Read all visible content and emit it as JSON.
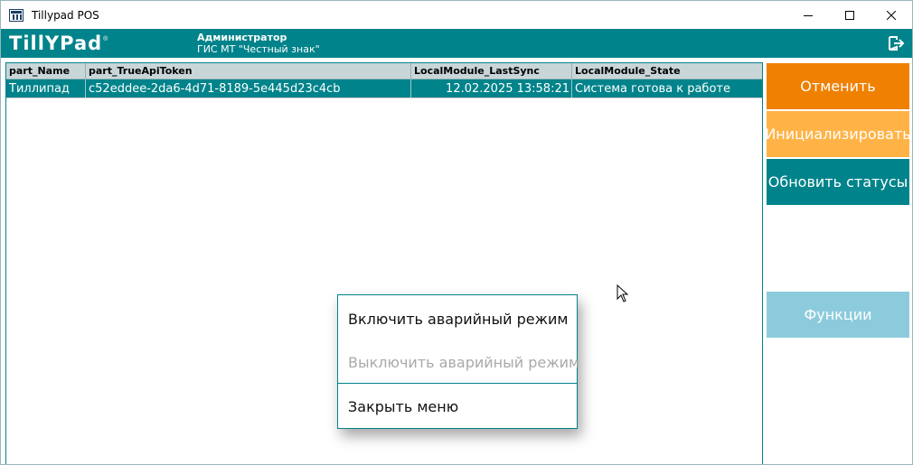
{
  "window": {
    "title": "Tillypad POS"
  },
  "header": {
    "logo_text": "TillYPad",
    "logo_reg": "®",
    "user_role": "Администратор",
    "user_sub": "ГИС МТ \"Честный знак\""
  },
  "table": {
    "columns": [
      "part_Name",
      "part_TrueApiToken",
      "LocalModule_LastSync",
      "LocalModule_State"
    ],
    "rows": [
      {
        "name": "Тиллипад",
        "token": "c52eddee-2da6-4d71-8189-5e445d23c4cb",
        "last_sync": "12.02.2025 13:58:21",
        "state": "Система готова к работе"
      }
    ]
  },
  "side_buttons": {
    "cancel": "Отменить",
    "initialize": "Инициализировать",
    "refresh": "Обновить статусы",
    "functions": "Функции"
  },
  "context_menu": {
    "enable_emergency": "Включить аварийный режим",
    "disable_emergency": "Выключить аварийный режим",
    "close_menu": "Закрыть меню"
  },
  "colors": {
    "brand_teal": "#00838a",
    "orange": "#ef8000",
    "light_orange": "#ffb347",
    "light_blue": "#8ccbdb"
  }
}
